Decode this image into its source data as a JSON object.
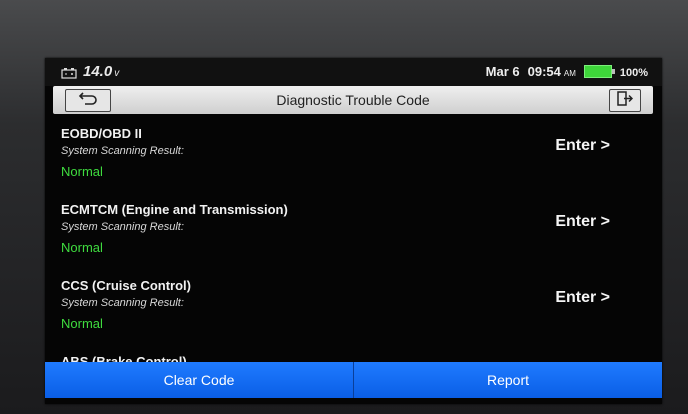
{
  "status": {
    "voltage": "14.0",
    "voltage_unit": "v",
    "date": "Mar 6",
    "time": "09:54",
    "ampm": "AM",
    "battery": "100%"
  },
  "header": {
    "title": "Diagnostic Trouble Code"
  },
  "items": [
    {
      "title": "EOBD/OBD II",
      "subtitle": "System Scanning Result:",
      "status": "Normal",
      "action": "Enter >"
    },
    {
      "title": "ECMTCM (Engine and Transmission)",
      "subtitle": "System Scanning Result:",
      "status": "Normal",
      "action": "Enter >"
    },
    {
      "title": "CCS (Cruise Control)",
      "subtitle": "System Scanning Result:",
      "status": "Normal",
      "action": "Enter >"
    },
    {
      "title": "ABS (Brake Control)",
      "subtitle": "",
      "status": "",
      "action": ""
    }
  ],
  "footer": {
    "clear_label": "Clear Code",
    "report_label": "Report"
  },
  "colors": {
    "accent": "#1f7bff",
    "status_normal": "#3fdc3f"
  }
}
